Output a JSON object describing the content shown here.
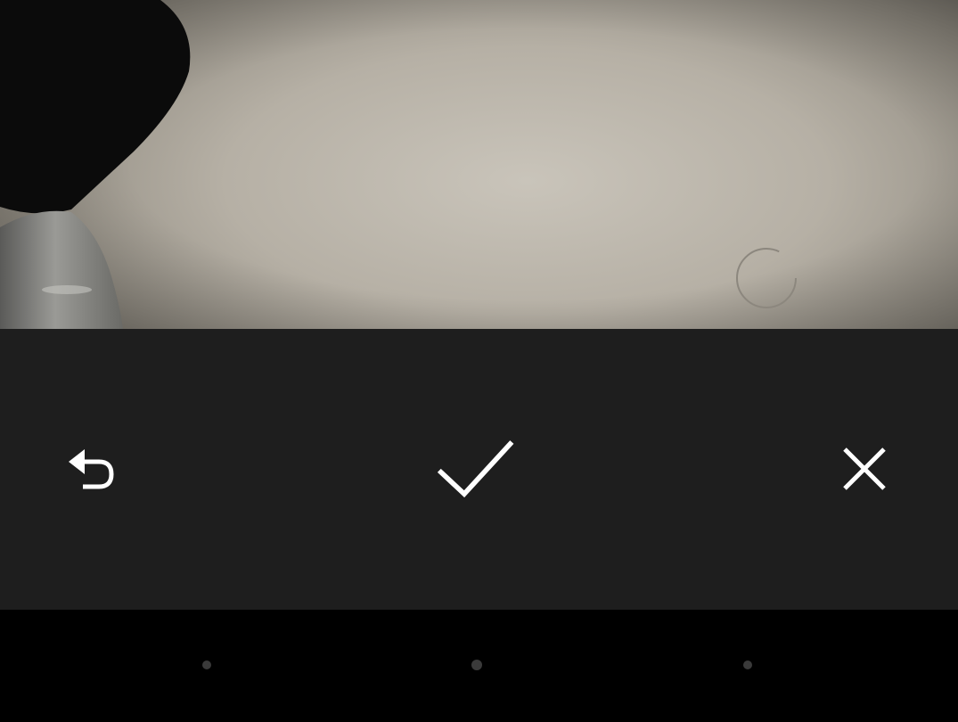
{
  "camera_preview": {
    "description_icon": "camera-viewfinder-image"
  },
  "toolbar": {
    "retake_icon": "undo-arrow-icon",
    "confirm_icon": "checkmark-icon",
    "cancel_icon": "close-icon",
    "icon_color": "#ffffff",
    "background_color": "#1e1e1e"
  },
  "navigation_bar": {
    "background_color": "#000000",
    "buttons": [
      "back-dot",
      "home-dot",
      "recent-apps-dot"
    ]
  }
}
